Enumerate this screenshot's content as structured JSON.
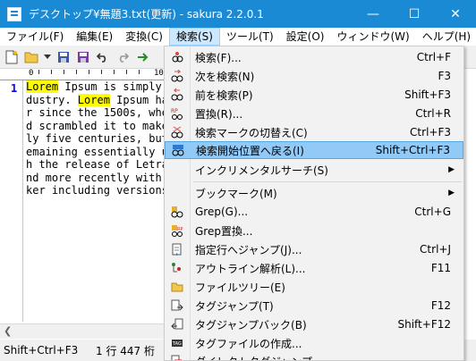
{
  "titlebar": {
    "title": "デスクトップ¥無題3.txt(更新) - sakura 2.2.0.1",
    "minimize": "—",
    "maximize": "☐",
    "close": "✕"
  },
  "menubar": [
    {
      "label": "ファイル(F)"
    },
    {
      "label": "編集(E)"
    },
    {
      "label": "変換(C)"
    },
    {
      "label": "検索(S)"
    },
    {
      "label": "ツール(T)"
    },
    {
      "label": "設定(O)"
    },
    {
      "label": "ウィンドウ(W)"
    },
    {
      "label": "ヘルプ(H)"
    }
  ],
  "toolbar": {
    "icons": [
      "new-file-icon",
      "open-folder-icon",
      "dropdown-arrow-icon",
      "save-icon",
      "save-all-icon",
      "undo-icon",
      "redo-icon",
      "search-icon"
    ]
  },
  "ruler": {
    "zero": "0",
    "ten": "10"
  },
  "editor": {
    "line_number": "1",
    "lines": [
      {
        "pre": "",
        "hl": "Lorem",
        "post": " Ipsum is simply"
      },
      {
        "pre": "dustry. ",
        "hl": "Lorem",
        "post": " Ipsum ha"
      },
      {
        "pre": "r since the 1500s, whe",
        "hl": "",
        "post": ""
      },
      {
        "pre": "d scrambled it to make",
        "hl": "",
        "post": ""
      },
      {
        "pre": "ly five centuries, but",
        "hl": "",
        "post": ""
      },
      {
        "pre": "emaining essentially u",
        "hl": "",
        "post": ""
      },
      {
        "pre": "h the release of Letra",
        "hl": "",
        "post": ""
      },
      {
        "pre": "nd more recently with",
        "hl": "",
        "post": ""
      },
      {
        "pre": "ker including versions",
        "hl": "",
        "post": ""
      }
    ]
  },
  "statusbar": {
    "shortcut_hint": "Shift+Ctrl+F3",
    "position": "1 行  447 桁"
  },
  "search_menu": {
    "items": [
      {
        "label": "検索(F)...",
        "shortcut": "Ctrl+F",
        "icon": "find-icon"
      },
      {
        "label": "次を検索(N)",
        "shortcut": "F3",
        "icon": "find-next-icon"
      },
      {
        "label": "前を検索(P)",
        "shortcut": "Shift+F3",
        "icon": "find-prev-icon"
      },
      {
        "label": "置換(R)...",
        "shortcut": "Ctrl+R",
        "icon": "replace-icon"
      },
      {
        "label": "検索マークの切替え(C)",
        "shortcut": "Ctrl+F3",
        "icon": "toggle-search-mark-icon"
      },
      {
        "label": "検索開始位置へ戻る(I)",
        "shortcut": "Shift+Ctrl+F3",
        "icon": "return-to-search-start-icon"
      },
      {
        "label": "インクリメンタルサーチ(S)",
        "shortcut": "",
        "icon": ""
      },
      {
        "label": "ブックマーク(M)",
        "shortcut": "",
        "icon": ""
      },
      {
        "label": "Grep(G)...",
        "shortcut": "Ctrl+G",
        "icon": "grep-icon"
      },
      {
        "label": "Grep置換...",
        "shortcut": "",
        "icon": "grep-replace-icon"
      },
      {
        "label": "指定行へジャンプ(J)...",
        "shortcut": "Ctrl+J",
        "icon": "jump-to-line-icon"
      },
      {
        "label": "アウトライン解析(L)...",
        "shortcut": "F11",
        "icon": "outline-icon"
      },
      {
        "label": "ファイルツリー(E)",
        "shortcut": "",
        "icon": "file-tree-icon"
      },
      {
        "label": "タグジャンプ(T)",
        "shortcut": "F12",
        "icon": "tag-jump-icon"
      },
      {
        "label": "タグジャンプバック(B)",
        "shortcut": "Shift+F12",
        "icon": "tag-jump-back-icon"
      },
      {
        "label": "タグファイルの作成...",
        "shortcut": "",
        "icon": "tag-file-icon"
      },
      {
        "label": "ダイレクトタグジャンプ",
        "shortcut": "",
        "icon": "direct-tag-jump-icon"
      }
    ],
    "submenu_arrow": "▶"
  },
  "colors": {
    "titlebar": "#1a8ad4",
    "menu_highlight": "#91c9f7",
    "line_number": "#0000ff",
    "search_highlight": "#ffff00"
  }
}
